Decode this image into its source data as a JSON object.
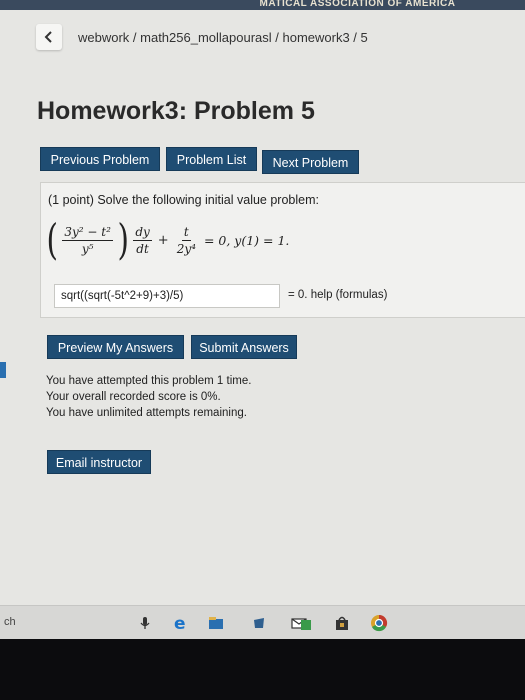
{
  "top_banner": "MATICAL ASSOCIATION OF AMERICA",
  "breadcrumb": "webwork / math256_mollapourasl / homework3 / 5",
  "page_title": "Homework3: Problem 5",
  "nav": {
    "previous": "Previous Problem",
    "list": "Problem List",
    "next": "Next Problem"
  },
  "problem": {
    "prompt": "(1 point) Solve the following initial value problem:",
    "eq_num": "3y² − t²",
    "eq_den": "y⁵",
    "dy": "dy",
    "dt": "dt",
    "plus": "+",
    "t_num": "t",
    "t_den": "2y⁴",
    "tail": "= 0,  y(1) = 1."
  },
  "answer": {
    "value": "sqrt((sqrt(-5t^2+9)+3)/5)",
    "suffix": "= 0.",
    "help": "help (formulas)"
  },
  "actions": {
    "preview": "Preview My Answers",
    "submit": "Submit Answers"
  },
  "status": {
    "line1": "You have attempted this problem 1 time.",
    "line2": "Your overall recorded score is 0%.",
    "line3": "You have unlimited attempts remaining."
  },
  "email_button": "Email instructor",
  "taskbar": {
    "search_text": "ch"
  },
  "colors": {
    "button": "#1f4d73",
    "background": "#e6e6e3"
  }
}
